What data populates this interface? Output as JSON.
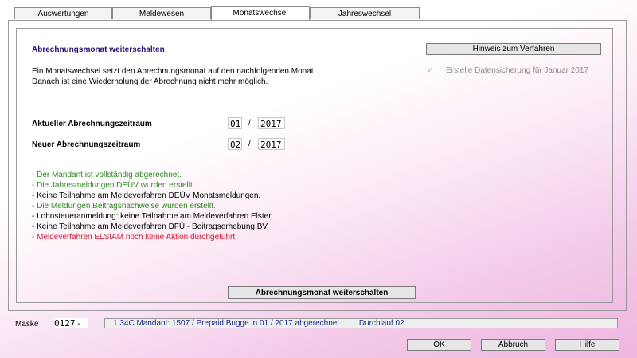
{
  "tabs": [
    {
      "label": "Auswertungen"
    },
    {
      "label": "Meldewesen"
    },
    {
      "label": "Monatswechsel"
    },
    {
      "label": "Jahreswechsel"
    }
  ],
  "section": {
    "title": "Abrechnungsmonat weiterschalten",
    "desc_line1": "Ein Monatswechsel setzt den Abrechnungsmonat auf den nachfolgenden Monat.",
    "desc_line2": "Danach ist eine Wiederholung der Abrechnung nicht mehr möglich."
  },
  "hint_button": "Hinweis zum Verfahren",
  "backup_checkbox": {
    "label": "Erstelle Datensicherung für Januar 2017",
    "checked": true
  },
  "periods": {
    "current_label": "Aktueller Abrechnungszeitraum",
    "current_month": "01",
    "current_year": "2017",
    "new_label": "Neuer Abrechnungszeitraum",
    "new_month": "02",
    "new_year": "2017",
    "separator": "/"
  },
  "messages": [
    {
      "text": "- Der Mandant ist vollständig abgerechnet.",
      "color": "#2d8a1f"
    },
    {
      "text": "- Die Jahresmeldungen DEÜV wurden erstellt.",
      "color": "#2d8a1f"
    },
    {
      "text": "- Keine Teilnahme am Meldeverfahren DEÜV Monatsmeldungen.",
      "color": "#000000"
    },
    {
      "text": "- Die Meldungen Beitragsnachweise wurden erstellt.",
      "color": "#2d8a1f"
    },
    {
      "text": "- Lohnsteueranmeldung: keine Teilnahme am Meldeverfahren Elster.",
      "color": "#000000"
    },
    {
      "text": "- Keine Teilnahme am Meldeverfahren DFÜ - Beitragserhebung BV.",
      "color": "#000000"
    },
    {
      "text": "- Meldeverfahren ELStAM noch keine Aktion durchgeführt!",
      "color": "#e0132b"
    }
  ],
  "action_button": "Abrechnungsmonat weiterschalten",
  "footer": {
    "maske_label": "Maske",
    "maske_value": "0127",
    "status_text": "1.34C Mandant: 1507 / Prepaid Bugge in 01 / 2017 abgerechnet",
    "status_run": "Durchlauf 02",
    "ok": "OK",
    "cancel": "Abbruch",
    "help": "Hilfe"
  }
}
